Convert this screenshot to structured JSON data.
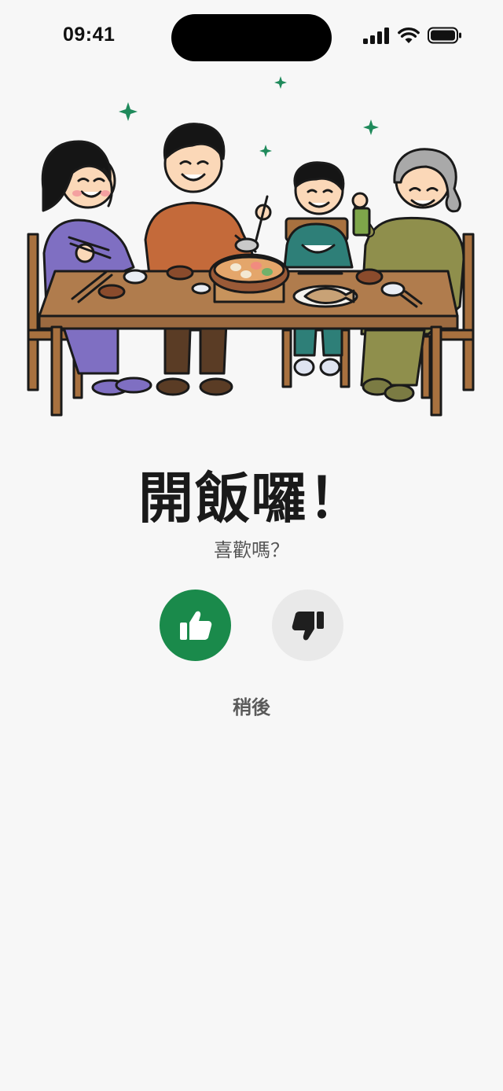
{
  "status_bar": {
    "time": "09:41",
    "icons": [
      "cellular-signal-icon",
      "wifi-icon",
      "battery-icon"
    ]
  },
  "illustration": {
    "name": "family-dinner-illustration",
    "sparkle_color": "#1f8a5b"
  },
  "prompt": {
    "title": "開飯囉！",
    "subtitle": "喜歡嗎？"
  },
  "actions": {
    "like": {
      "icon": "thumbs-up-icon",
      "color": "#1a8a4b"
    },
    "dislike": {
      "icon": "thumbs-down-icon",
      "color": "#e9e9e9"
    },
    "later_label": "稍後"
  }
}
